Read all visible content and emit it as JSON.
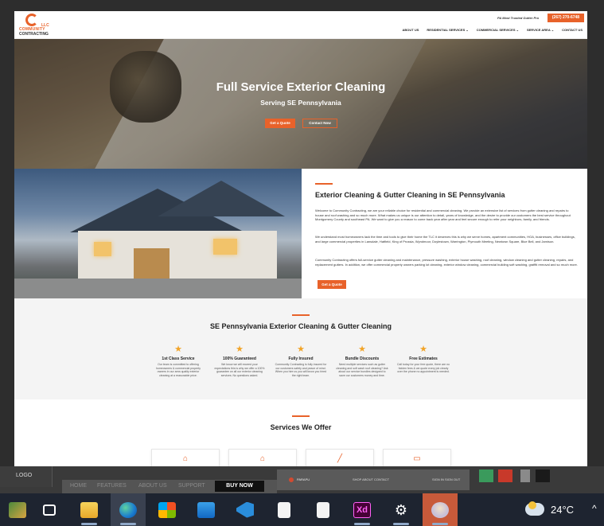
{
  "site": {
    "logo_top": "COMMUNITY",
    "logo_bottom": "CONTRACTING",
    "logo_llc": "LLC",
    "tagline": "PA Most Trusted Gutter Pro",
    "phone": "(267) 270-6748",
    "nav": [
      "ABOUT US",
      "RESIDENTIAL SERVICES ⌄",
      "COMMERCIAL SERVICES ⌄",
      "SERVICE AREA ⌄",
      "CONTACT US"
    ]
  },
  "hero": {
    "title": "Full Service Exterior Cleaning",
    "subtitle": "Serving SE Pennsylvania",
    "quote_button": "Get a Quote",
    "contact_button": "Contact Now"
  },
  "about": {
    "title": "Exterior Cleaning & Gutter Cleaning in SE Pennsylvania",
    "p1": "Welcome to Community Contracting, we are your reliable choice for residential and commercial cleaning. We provide an extensive list of services from gutter cleaning and repairs to house and roof washing and so much more. What makes us unique is our attention to detail, years of knowledge, and the desire to provide our customers the best service throughout Montgomery County and southeast PA. We want to give you a reason to come back year after year and feel secure enough to refer your neighbors, family, and friends.",
    "p2": "We understand most homeowners lack the time and tools to give their home the TLC it deserves this is why we serve homes, apartment communities, HOA, businesses, office buildings, and large commercial properties in Lansdale, Hatfield, King of Prussia, Wyndmoor, Doylestown, Warrington, Plymouth Meeting, Newtown Square, Blue Bell, and Jamison.",
    "p3": "Community Contracting offers full-service gutter cleaning and maintenance, pressure washing, exterior house washing, roof cleaning, window cleaning and gutter cleaning, repairs, and replacement gutters. In addition, we offer commercial property owners parking lot cleaning, exterior window cleaning, commercial building soft washing, graffiti removal and so much more.",
    "button": "Get a Quote"
  },
  "features": {
    "title": "SE Pennsylvania Exterior Cleaning & Gutter Cleaning",
    "items": [
      {
        "title": "1st Class Service",
        "desc": "Our team is committed to offering homeowners & commercial property owners in our area quality exterior cleaning at a reasonable price."
      },
      {
        "title": "100% Guaranteed",
        "desc": "We know we will exceed your expectations this is why we offer a 100% guarantee on all our exterior cleaning services. No questions asked."
      },
      {
        "title": "Fully Insured",
        "desc": "Community Contracting is fully insured for our customers safety and peace of mind. When you hire us you will know you hired the right team."
      },
      {
        "title": "Bundle Discounts",
        "desc": "Need multiple services such as gutter cleaning and soft wash roof cleaning? Ask about our service bundles designed to save our customers money and time."
      },
      {
        "title": "Free Estimates",
        "desc": "Call today for your free quote, there are no hidden fees & we quote every job clearly over the phone no appointment is needed."
      }
    ]
  },
  "services": {
    "title": "Services We Offer"
  },
  "overlay": {
    "logo": "LOGO",
    "nav": [
      "HOME",
      "FEATURES",
      "ABOUT US",
      "SUPPORT"
    ],
    "buy": "BUY NOW",
    "brand": "PARAPU",
    "links": "SHOP    ABOUT    CONTACT",
    "sign": "SIGN IN    SIGN OUT",
    "swatches": [
      "#3a9a5c",
      "#c8392a",
      "#8a8a8a",
      "#1a1a1a"
    ]
  },
  "taskbar": {
    "apps": [
      "widgets-icon",
      "task-view-icon",
      "file-explorer-icon",
      "edge-icon",
      "store-icon",
      "mail-icon",
      "vscode-icon",
      "document-icon",
      "document-icon",
      "xd-icon",
      "settings-icon",
      "paint-icon"
    ],
    "temperature": "24°C"
  }
}
